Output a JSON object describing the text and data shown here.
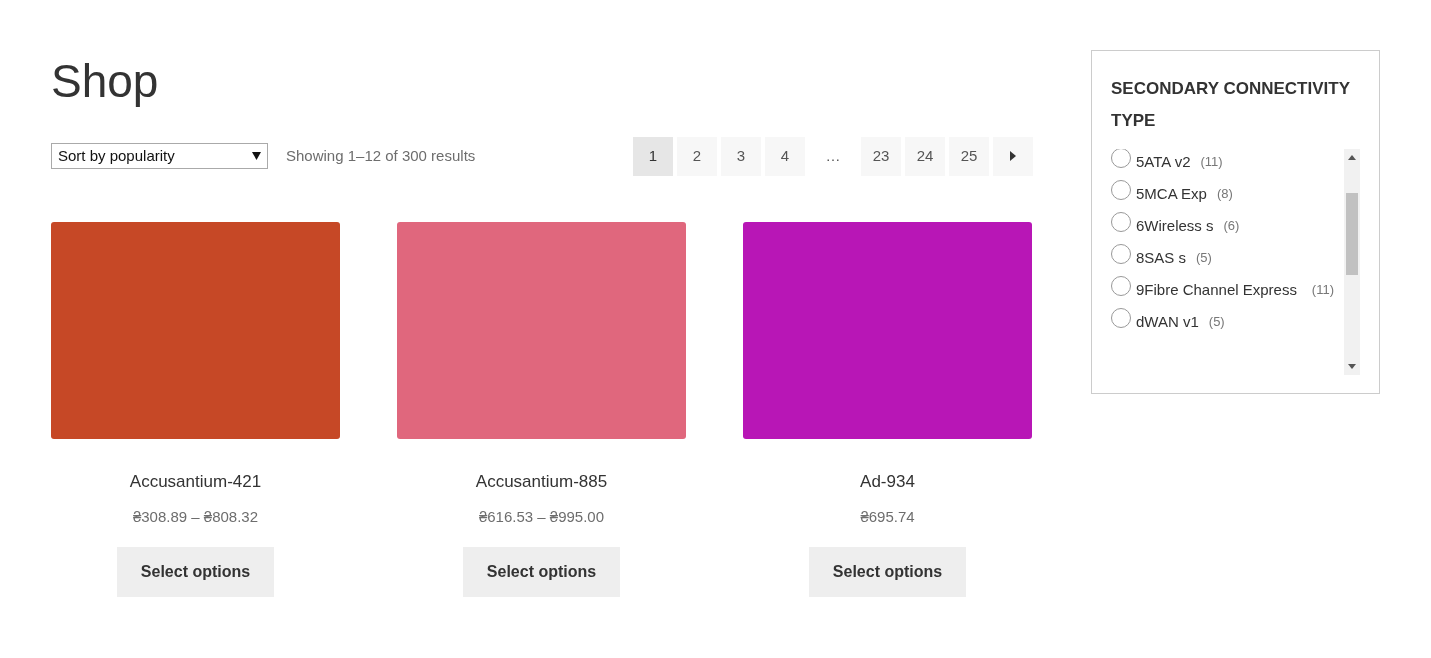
{
  "page_title": "Shop",
  "sort": {
    "value": "Sort by popularity"
  },
  "result_count": "Showing 1–12 of 300 results",
  "pagination": [
    {
      "kind": "page",
      "label": "1",
      "selected": true
    },
    {
      "kind": "page",
      "label": "2",
      "selected": false
    },
    {
      "kind": "page",
      "label": "3",
      "selected": false
    },
    {
      "kind": "page",
      "label": "4",
      "selected": false
    },
    {
      "kind": "dots",
      "label": "…",
      "selected": false
    },
    {
      "kind": "page",
      "label": "23",
      "selected": false
    },
    {
      "kind": "page",
      "label": "24",
      "selected": false
    },
    {
      "kind": "page",
      "label": "25",
      "selected": false
    },
    {
      "kind": "next",
      "selected": false
    }
  ],
  "products": [
    {
      "color": "#c64826",
      "name": "Accusantium-421",
      "price": "₴308.89 – ₴808.32",
      "button": "Select options"
    },
    {
      "color": "#e0677d",
      "name": "Accusantium-885",
      "price": "₴616.53 – ₴995.00",
      "button": "Select options"
    },
    {
      "color": "#b816b6",
      "name": "Ad-934",
      "price": "₴695.74",
      "button": "Select options"
    }
  ],
  "sidebar": {
    "title": "SECONDARY CONNECTIVITY TYPE",
    "filters": [
      {
        "label": "5ATA v2",
        "count": "(11)",
        "checked": false
      },
      {
        "label": "5MCA Exp",
        "count": "(8)",
        "checked": false
      },
      {
        "label": "6Wireless s",
        "count": "(6)",
        "checked": false
      },
      {
        "label": "8SAS s",
        "count": "(5)",
        "checked": false
      },
      {
        "label": "9Fibre Channel Express",
        "count": "(11)",
        "checked": false
      },
      {
        "label": "dWAN v1",
        "count": "(5)",
        "checked": false
      }
    ]
  }
}
